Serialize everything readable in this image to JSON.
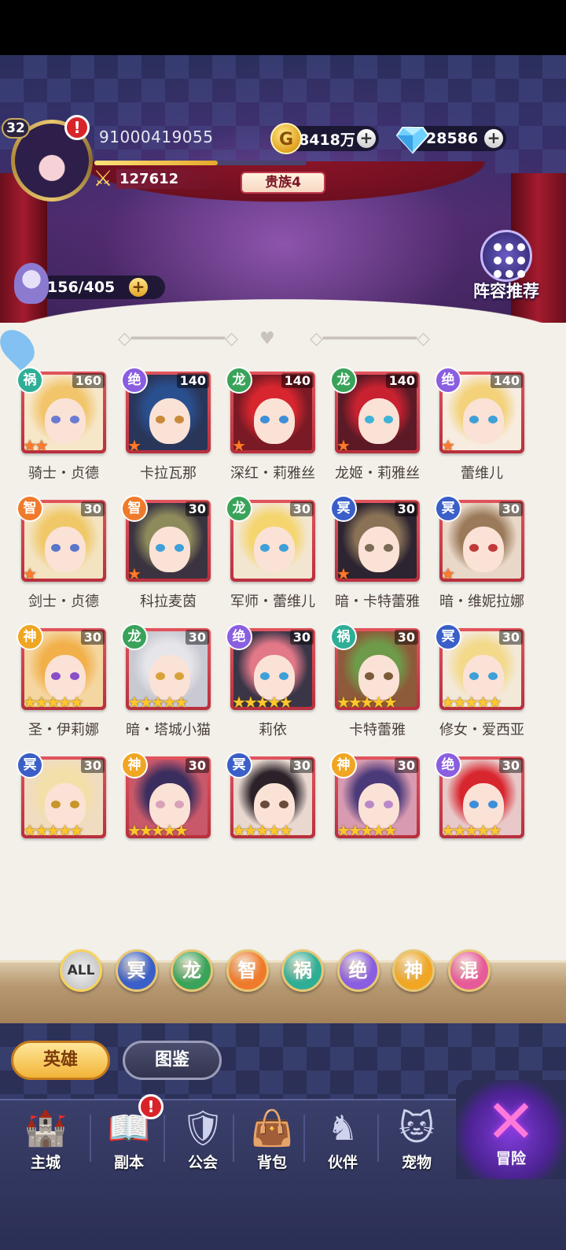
{
  "player": {
    "level": "32",
    "id": "91000419055",
    "exp_fraction": 0.58,
    "power": "127612",
    "noble": "贵族4"
  },
  "currencies": {
    "gold": {
      "icon_letter": "G",
      "value": "8418万"
    },
    "diamond": {
      "value": "28586"
    }
  },
  "stamina": {
    "value": "156/405"
  },
  "formation": {
    "label": "阵容推荐"
  },
  "factions": {
    "祸": "#2fae96",
    "绝": "#8a5ee0",
    "龙": "#3aa35a",
    "智": "#f07a2b",
    "冥": "#3b5fc8",
    "神": "#f0a623",
    "混": "#e75a9a"
  },
  "heroes": [
    {
      "name": "骑士・贞德",
      "faction": "祸",
      "level": "160",
      "stars": 2,
      "gold": false,
      "hair": "#f2c56b",
      "bg": "#f6e7c9",
      "eyes": "#6b7bd1"
    },
    {
      "name": "卡拉瓦那",
      "faction": "绝",
      "level": "140",
      "stars": 1,
      "gold": false,
      "hair": "#2a4f8f",
      "bg": "#29365a",
      "eyes": "#c98a3a"
    },
    {
      "name": "深红・莉雅丝",
      "faction": "龙",
      "level": "140",
      "stars": 1,
      "gold": false,
      "hair": "#d8262f",
      "bg": "#7a1a24",
      "eyes": "#3f8ed8"
    },
    {
      "name": "龙姬・莉雅丝",
      "faction": "龙",
      "level": "140",
      "stars": 1,
      "gold": false,
      "hair": "#c82130",
      "bg": "#5c1a26",
      "eyes": "#3fb3d8"
    },
    {
      "name": "蕾维儿",
      "faction": "绝",
      "level": "140",
      "stars": 1,
      "gold": false,
      "hair": "#f3d27a",
      "bg": "#f7ece0",
      "eyes": "#3fa0d8"
    },
    {
      "name": "剑士・贞德",
      "faction": "智",
      "level": "30",
      "stars": 1,
      "gold": false,
      "hair": "#f0c867",
      "bg": "#f3e3c1",
      "eyes": "#5a77c8"
    },
    {
      "name": "科拉麦茵",
      "faction": "智",
      "level": "30",
      "stars": 1,
      "gold": false,
      "hair": "#8d8a5c",
      "bg": "#3b3440",
      "eyes": "#3fa0d8"
    },
    {
      "name": "军师・蕾维儿",
      "faction": "龙",
      "level": "30",
      "stars": 0,
      "gold": false,
      "hair": "#f5d56e",
      "bg": "#f2e6d0",
      "eyes": "#3fa0d8"
    },
    {
      "name": "暗・卡特蕾雅",
      "faction": "冥",
      "level": "30",
      "stars": 1,
      "gold": false,
      "hair": "#8a7257",
      "bg": "#2c2430",
      "eyes": "#7b6a55"
    },
    {
      "name": "暗・维妮拉娜",
      "faction": "冥",
      "level": "30",
      "stars": 1,
      "gold": false,
      "hair": "#9b7a5a",
      "bg": "#e9d8c8",
      "eyes": "#c03a3a"
    },
    {
      "name": "圣・伊莉娜",
      "faction": "神",
      "level": "30",
      "stars": 5,
      "gold": true,
      "hair": "#f2b04a",
      "bg": "#f4d6a0",
      "eyes": "#8a4fc8"
    },
    {
      "name": "暗・塔城小猫",
      "faction": "龙",
      "level": "30",
      "stars": 5,
      "gold": true,
      "hair": "#e6e6ea",
      "bg": "#c9c9d2",
      "eyes": "#d8a23a"
    },
    {
      "name": "莉依",
      "faction": "绝",
      "level": "30",
      "stars": 5,
      "gold": true,
      "hair": "#e27888",
      "bg": "#3a3648",
      "eyes": "#3fa0d8"
    },
    {
      "name": "卡特蕾雅",
      "faction": "祸",
      "level": "30",
      "stars": 5,
      "gold": true,
      "hair": "#6e9b4a",
      "bg": "#8d5a3a",
      "eyes": "#7b5a3a"
    },
    {
      "name": "修女・爱西亚",
      "faction": "冥",
      "level": "30",
      "stars": 5,
      "gold": true,
      "hair": "#f3d98a",
      "bg": "#f3e9d8",
      "eyes": "#3fa0d8"
    },
    {
      "name": "",
      "faction": "冥",
      "level": "30",
      "stars": 5,
      "gold": true,
      "hair": "#f2e0a8",
      "bg": "#f0dcc0",
      "eyes": "#c8952a"
    },
    {
      "name": "",
      "faction": "神",
      "level": "30",
      "stars": 5,
      "gold": true,
      "hair": "#3a2e5e",
      "bg": "#c8586a",
      "eyes": "#d8a2b8"
    },
    {
      "name": "",
      "faction": "冥",
      "level": "30",
      "stars": 5,
      "gold": true,
      "hair": "#2a2228",
      "bg": "#e8d8d0",
      "eyes": "#6a4a3a"
    },
    {
      "name": "",
      "faction": "神",
      "level": "30",
      "stars": 5,
      "gold": true,
      "hair": "#4a3a7a",
      "bg": "#d89ab0",
      "eyes": "#b888c8"
    },
    {
      "name": "",
      "faction": "绝",
      "level": "30",
      "stars": 5,
      "gold": true,
      "hair": "#d8262f",
      "bg": "#e8c8c8",
      "eyes": "#3f8ed8"
    }
  ],
  "filters": [
    "ALL",
    "冥",
    "龙",
    "智",
    "祸",
    "绝",
    "神",
    "混"
  ],
  "tabs": {
    "heroes": "英雄",
    "codex": "图鉴"
  },
  "nav": [
    {
      "label": "主城",
      "icon": "castle-icon",
      "glyph": "🏰"
    },
    {
      "label": "副本",
      "icon": "book-icon",
      "glyph": "📖"
    },
    {
      "label": "公会",
      "icon": "guild-shield-icon",
      "glyph": "🛡"
    },
    {
      "label": "背包",
      "icon": "bag-icon",
      "glyph": "👜"
    },
    {
      "label": "伙伴",
      "icon": "partner-icon",
      "glyph": "♞"
    },
    {
      "label": "宠物",
      "icon": "pet-icon",
      "glyph": "🐱"
    }
  ],
  "adventure": {
    "label": "冒险",
    "glyph": "✕"
  },
  "alerts": {
    "avatar": "!",
    "dungeon": "!"
  }
}
